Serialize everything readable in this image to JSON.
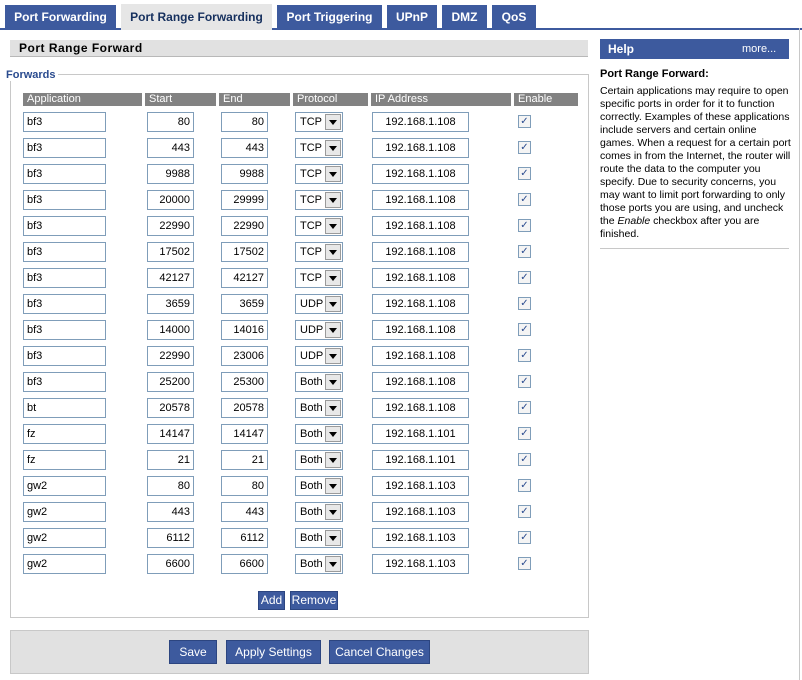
{
  "tabs": [
    {
      "label": "Port Forwarding",
      "active": false
    },
    {
      "label": "Port Range Forwarding",
      "active": true
    },
    {
      "label": "Port Triggering",
      "active": false
    },
    {
      "label": "UPnP",
      "active": false
    },
    {
      "label": "DMZ",
      "active": false
    },
    {
      "label": "QoS",
      "active": false
    }
  ],
  "section": {
    "title": "Port Range Forward",
    "legend": "Forwards"
  },
  "columns": {
    "application": "Application",
    "start": "Start",
    "end": "End",
    "protocol": "Protocol",
    "ip": "IP Address",
    "enable": "Enable"
  },
  "rows": [
    {
      "app": "bf3",
      "start": "80",
      "end": "80",
      "protocol": "TCP",
      "ip": "192.168.1.108",
      "enabled": true
    },
    {
      "app": "bf3",
      "start": "443",
      "end": "443",
      "protocol": "TCP",
      "ip": "192.168.1.108",
      "enabled": true
    },
    {
      "app": "bf3",
      "start": "9988",
      "end": "9988",
      "protocol": "TCP",
      "ip": "192.168.1.108",
      "enabled": true
    },
    {
      "app": "bf3",
      "start": "20000",
      "end": "29999",
      "protocol": "TCP",
      "ip": "192.168.1.108",
      "enabled": true
    },
    {
      "app": "bf3",
      "start": "22990",
      "end": "22990",
      "protocol": "TCP",
      "ip": "192.168.1.108",
      "enabled": true
    },
    {
      "app": "bf3",
      "start": "17502",
      "end": "17502",
      "protocol": "TCP",
      "ip": "192.168.1.108",
      "enabled": true
    },
    {
      "app": "bf3",
      "start": "42127",
      "end": "42127",
      "protocol": "TCP",
      "ip": "192.168.1.108",
      "enabled": true
    },
    {
      "app": "bf3",
      "start": "3659",
      "end": "3659",
      "protocol": "UDP",
      "ip": "192.168.1.108",
      "enabled": true
    },
    {
      "app": "bf3",
      "start": "14000",
      "end": "14016",
      "protocol": "UDP",
      "ip": "192.168.1.108",
      "enabled": true
    },
    {
      "app": "bf3",
      "start": "22990",
      "end": "23006",
      "protocol": "UDP",
      "ip": "192.168.1.108",
      "enabled": true
    },
    {
      "app": "bf3",
      "start": "25200",
      "end": "25300",
      "protocol": "Both",
      "ip": "192.168.1.108",
      "enabled": true
    },
    {
      "app": "bt",
      "start": "20578",
      "end": "20578",
      "protocol": "Both",
      "ip": "192.168.1.108",
      "enabled": true
    },
    {
      "app": "fz",
      "start": "14147",
      "end": "14147",
      "protocol": "Both",
      "ip": "192.168.1.101",
      "enabled": true
    },
    {
      "app": "fz",
      "start": "21",
      "end": "21",
      "protocol": "Both",
      "ip": "192.168.1.101",
      "enabled": true
    },
    {
      "app": "gw2",
      "start": "80",
      "end": "80",
      "protocol": "Both",
      "ip": "192.168.1.103",
      "enabled": true
    },
    {
      "app": "gw2",
      "start": "443",
      "end": "443",
      "protocol": "Both",
      "ip": "192.168.1.103",
      "enabled": true
    },
    {
      "app": "gw2",
      "start": "6112",
      "end": "6112",
      "protocol": "Both",
      "ip": "192.168.1.103",
      "enabled": true
    },
    {
      "app": "gw2",
      "start": "6600",
      "end": "6600",
      "protocol": "Both",
      "ip": "192.168.1.103",
      "enabled": true
    }
  ],
  "table_buttons": {
    "add": "Add",
    "remove": "Remove"
  },
  "footer_buttons": {
    "save": "Save",
    "apply": "Apply Settings",
    "cancel": "Cancel Changes"
  },
  "help": {
    "header": "Help",
    "more": "more...",
    "title": "Port Range Forward:",
    "body_before": "Certain applications may require to open specific ports in order for it to function correctly. Examples of these applications include servers and certain online games. When a request for a certain port comes in from the Internet, the router will route the data to the computer you specify. Due to security concerns, you may want to limit port forwarding to only those ports you are using, and uncheck the ",
    "body_emphasis": "Enable",
    "body_after": " checkbox after you are finished."
  },
  "colors": {
    "primary": "#3d5a9e",
    "header_gray": "#828282",
    "panel_gray": "#e1e1e1",
    "legend_blue": "#2a4b8f"
  }
}
